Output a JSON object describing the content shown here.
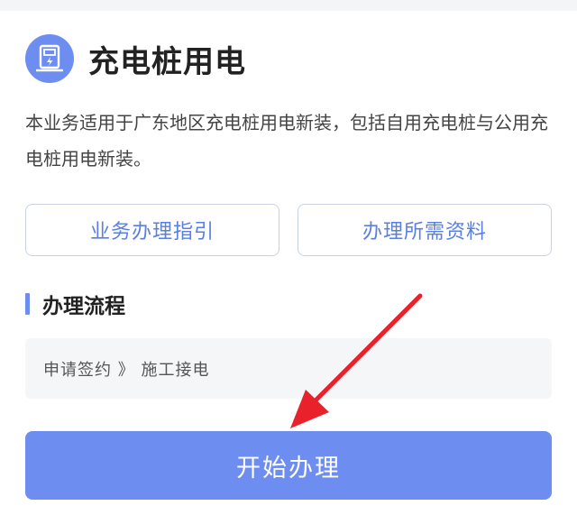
{
  "header": {
    "icon": "charging-pile-icon",
    "title": "充电桩用电"
  },
  "description": "本业务适用于广东地区充电桩用电新装，包括自用充电桩与公用充电桩用电新装。",
  "buttons": {
    "guide_label": "业务办理指引",
    "docs_label": "办理所需资料"
  },
  "process": {
    "section_title": "办理流程",
    "steps_text": "申请签约 》 施工接电"
  },
  "start_button_label": "开始办理",
  "colors": {
    "accent": "#6d8ef0",
    "annotation_arrow": "#e8212a"
  }
}
